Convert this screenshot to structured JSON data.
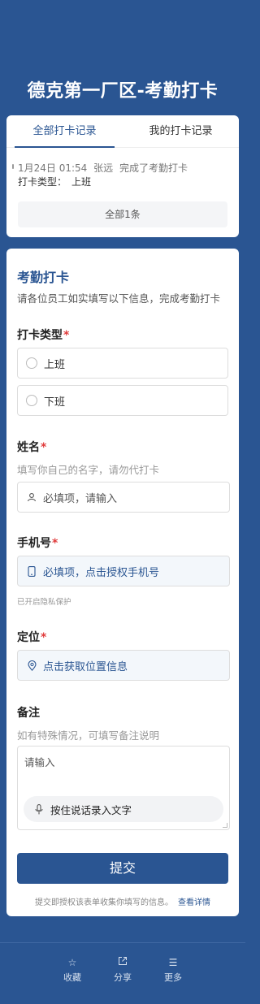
{
  "page": {
    "title": "德克第一厂区-考勤打卡"
  },
  "records": {
    "tabs": [
      "全部打卡记录",
      "我的打卡记录"
    ],
    "item": {
      "time": "1月24日 01:54",
      "user": "张远",
      "action": "完成了考勤打卡",
      "type_label": "打卡类型：",
      "type_value": "上班"
    },
    "all_button": "全部1条"
  },
  "form": {
    "title": "考勤打卡",
    "description": "请各位员工如实填写以下信息，完成考勤打卡",
    "q1": {
      "label": "打卡类型",
      "required": "*",
      "options": [
        "上班",
        "下班"
      ]
    },
    "q2": {
      "label": "姓名",
      "required": "*",
      "desc": "填写你自己的名字，请勿代打卡",
      "placeholder": "必填项，请输入"
    },
    "q3": {
      "label": "手机号",
      "required": "*",
      "placeholder": "必填项，点击授权手机号",
      "privacy": "已开启隐私保护"
    },
    "q4": {
      "label": "定位",
      "required": "*",
      "placeholder": "点击获取位置信息"
    },
    "q5": {
      "label": "备注",
      "desc": "如有特殊情况，可填写备注说明",
      "placeholder": "请输入",
      "voice": "按住说话录入文字"
    },
    "submit": "提交",
    "consent": "提交即授权该表单收集你填写的信息。",
    "consent_link": "查看详情"
  },
  "bottom_bar": {
    "items": [
      {
        "label": "收藏",
        "icon": "star-icon"
      },
      {
        "label": "分享",
        "icon": "share-icon"
      },
      {
        "label": "更多",
        "icon": "menu-icon"
      }
    ]
  },
  "colors": {
    "brand": "#2a5592",
    "required": "#e03b3b"
  }
}
